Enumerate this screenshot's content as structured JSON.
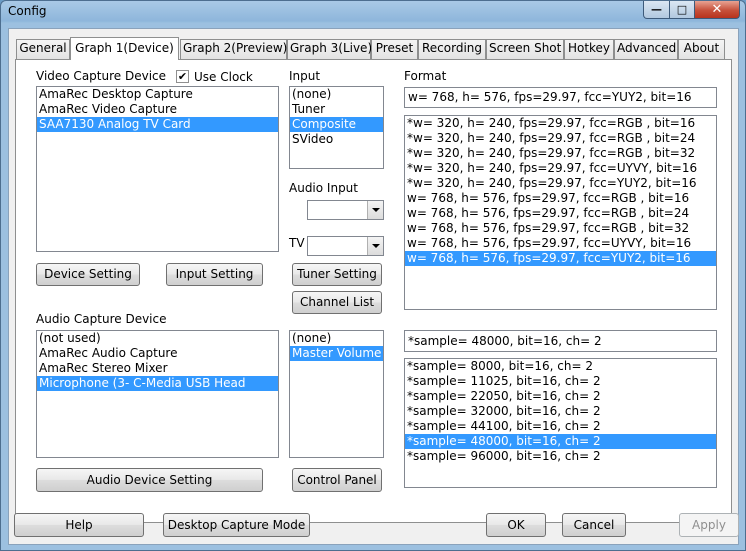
{
  "window": {
    "title": "Config"
  },
  "tabs": [
    {
      "label": "General"
    },
    {
      "label": "Graph 1(Device)"
    },
    {
      "label": "Graph 2(Preview)"
    },
    {
      "label": "Graph 3(Live)"
    },
    {
      "label": "Preset"
    },
    {
      "label": "Recording"
    },
    {
      "label": "Screen Shot"
    },
    {
      "label": "Hotkey"
    },
    {
      "label": "Advanced"
    },
    {
      "label": "About"
    }
  ],
  "video": {
    "label": "Video Capture Device",
    "use_clock_label": "Use Clock",
    "use_clock_mark": "✔",
    "devices": [
      "AmaRec Desktop Capture",
      "AmaRec Video Capture",
      "SAA7130 Analog TV Card"
    ],
    "device_setting": "Device Setting",
    "input_setting": "Input Setting"
  },
  "input": {
    "label": "Input",
    "items": [
      "(none)",
      "Tuner",
      "Composite",
      "SVideo"
    ],
    "audio_input_label": "Audio Input",
    "tv_label": "TV",
    "tuner_setting": "Tuner Setting",
    "channel_list": "Channel List"
  },
  "format": {
    "label": "Format",
    "current": "w= 768, h= 576, fps=29.97,  fcc=YUY2, bit=16",
    "items": [
      "*w= 320, h= 240, fps=29.97,  fcc=RGB , bit=16",
      "*w= 320, h= 240, fps=29.97,  fcc=RGB , bit=24",
      "*w= 320, h= 240, fps=29.97,  fcc=RGB , bit=32",
      "*w= 320, h= 240, fps=29.97,  fcc=UYVY, bit=16",
      "*w= 320, h= 240, fps=29.97,  fcc=YUY2, bit=16",
      "w= 768, h= 576, fps=29.97,  fcc=RGB , bit=16",
      "w= 768, h= 576, fps=29.97,  fcc=RGB , bit=24",
      "w= 768, h= 576, fps=29.97,  fcc=RGB , bit=32",
      "w= 768, h= 576, fps=29.97,  fcc=UYVY, bit=16",
      "w= 768, h= 576, fps=29.97,  fcc=YUY2, bit=16"
    ]
  },
  "audio": {
    "label": "Audio Capture Device",
    "devices": [
      "(not used)",
      "AmaRec Audio Capture",
      "AmaRec Stereo Mixer",
      "Microphone (3- C-Media USB Head"
    ],
    "device_setting": "Audio Device Setting",
    "lines": [
      "(none)",
      "Master Volume"
    ],
    "control_panel": "Control Panel",
    "current": "*sample= 48000, bit=16, ch= 2",
    "formats": [
      "*sample=  8000, bit=16, ch= 2",
      "*sample= 11025, bit=16, ch= 2",
      "*sample= 22050, bit=16, ch= 2",
      "*sample= 32000, bit=16, ch= 2",
      "*sample= 44100, bit=16, ch= 2",
      "*sample= 48000, bit=16, ch= 2",
      "*sample= 96000, bit=16, ch= 2"
    ]
  },
  "footer": {
    "help": "Help",
    "desktop_capture_mode": "Desktop Capture Mode",
    "ok": "OK",
    "cancel": "Cancel",
    "apply": "Apply"
  },
  "window_controls": {
    "minimize_glyph": "—",
    "maximize_glyph": "□",
    "close_glyph": "✕"
  }
}
